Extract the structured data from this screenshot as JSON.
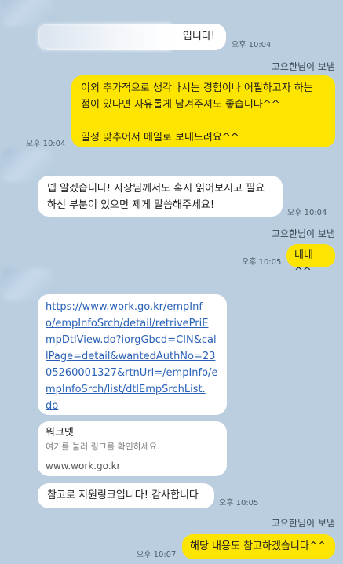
{
  "messages": {
    "first_incoming": {
      "text": "입니다!",
      "time": "오후 10:04"
    },
    "sender_label": "고요한님이 보냄",
    "outgoing_1": {
      "line1": "이외 추가적으로 생각나시는 경험이나 어필하고자 하는",
      "line2": "점이 있다면 자유롭게 남겨주셔도 좋습니다^^",
      "line3": "일정 맞추어서 메일로 보내드려요^^",
      "time": "오후 10:04"
    },
    "incoming_2": {
      "line1": "넵 알겠습니다! 사장님께서도 혹시 읽어보시고 필요",
      "line2": "하신 부분이 있으면 제게 말씀해주세요!",
      "time": "오후 10:04"
    },
    "outgoing_2": {
      "text": "네네^^",
      "time": "오후 10:05"
    },
    "link_message": {
      "lines": [
        "https://www.work.go.kr/empInf",
        "o/empInfoSrch/detail/retrivePriE",
        "mpDtlView.do?iorgGbcd=CIN&cal",
        "lPage=detail&wantedAuthNo=23",
        "05260001327&rtnUrl=/empInfo/e",
        "mpInfoSrch/list/dtlEmpSrchList.",
        "do"
      ]
    },
    "link_preview": {
      "title": "워크넷",
      "desc": "여기를 눌러 링크를 확인하세요.",
      "domain": "www.work.go.kr"
    },
    "incoming_3": {
      "text": "참고로 지원링크입니다! 감사합니다",
      "time": "오후 10:05"
    },
    "outgoing_3": {
      "text": "해당 내용도 참고하겠습니다^^",
      "time": "오후 10:07"
    }
  },
  "colors": {
    "background": "#bacee0",
    "outgoing_bubble": "#fee500",
    "incoming_bubble": "#ffffff",
    "link": "#2a61b7"
  }
}
